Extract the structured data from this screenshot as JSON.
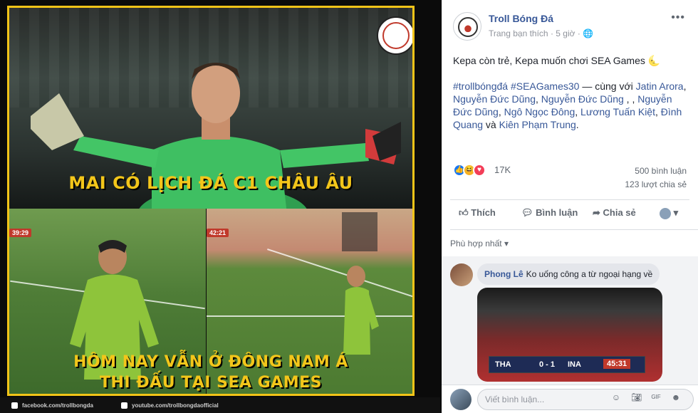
{
  "meme": {
    "caption_top": "MAI CÓ LỊCH ĐÁ C1 CHÂU ÂU",
    "caption_bottom_1": "HÔM NAY VẪN Ở ĐÔNG NAM Á",
    "caption_bottom_2": "THI ĐẤU TẠI SEA GAMES",
    "timer_left": "39:29",
    "timer_right": "42:21",
    "footer_facebook": "facebook.com/trollbongda",
    "footer_youtube": "youtube.com/trollbongdaofficial"
  },
  "post": {
    "page_name": "Troll Bóng Đá",
    "meta": "Trang bạn thích · 5 giờ · ",
    "body": "Kepa còn trẻ, Kepa muốn chơi SEA Games 🌜",
    "hashtags": "#trollbóngđá #SEAGames30",
    "with_text": " — cùng với ",
    "tags": [
      "Jatin Arora",
      "Nguyễn Đức Dũng",
      "Nguyễn Đức Dũng",
      "Nguyễn Đức Dũng",
      "Ngô Ngọc Đông",
      "Lương Tuấn Kiệt",
      "Đình Quang",
      "Kiên Phạm Trung"
    ],
    "sep_comma": ", ",
    "sep_double": " , , ",
    "and_word": " và ",
    "period": "."
  },
  "stats": {
    "reactions": "17K",
    "comments": "500 bình luận",
    "shares": "123 lượt chia sẻ"
  },
  "actions": {
    "like": "Thích",
    "comment": "Bình luận",
    "share": "Chia sẻ"
  },
  "sort": {
    "label": "Phù hợp nhất"
  },
  "comment": {
    "name": "Phong Lê",
    "text": "Ko uống công a từ ngoại hạng về",
    "score_left": "THA",
    "score": "0 - 1",
    "score_right": "INA",
    "time": "45:31"
  },
  "composer": {
    "placeholder": "Viết bình luận..."
  },
  "colors": {
    "fb_blue": "#385898",
    "meme_yellow": "#f3c61a",
    "sidebar_bg": "#ffffff"
  }
}
